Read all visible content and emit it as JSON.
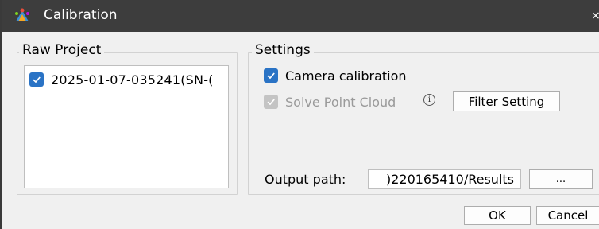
{
  "window": {
    "title": "Calibration",
    "close_glyph": "×"
  },
  "raw_project": {
    "legend": "Raw Project",
    "items": [
      {
        "label": "2025-01-07-035241(SN-(",
        "checked": true
      }
    ]
  },
  "settings": {
    "legend": "Settings",
    "camera_calibration": {
      "label": "Camera calibration",
      "checked": true,
      "enabled": true
    },
    "solve_point_cloud": {
      "label": "Solve Point Cloud",
      "checked": true,
      "enabled": false
    },
    "info_glyph": "i",
    "filter_button": "Filter Setting",
    "output_path_label": "Output path:",
    "output_path_value": ")220165410/Results",
    "browse_button": "..."
  },
  "footer": {
    "ok_label": "OK",
    "cancel_label": "Cancel"
  },
  "colors": {
    "titlebar": "#3d3d3d",
    "checkbox_accent": "#2a73c5",
    "checkbox_disabled": "#c4c4c4",
    "dialog_bg": "#f0f0f0"
  }
}
